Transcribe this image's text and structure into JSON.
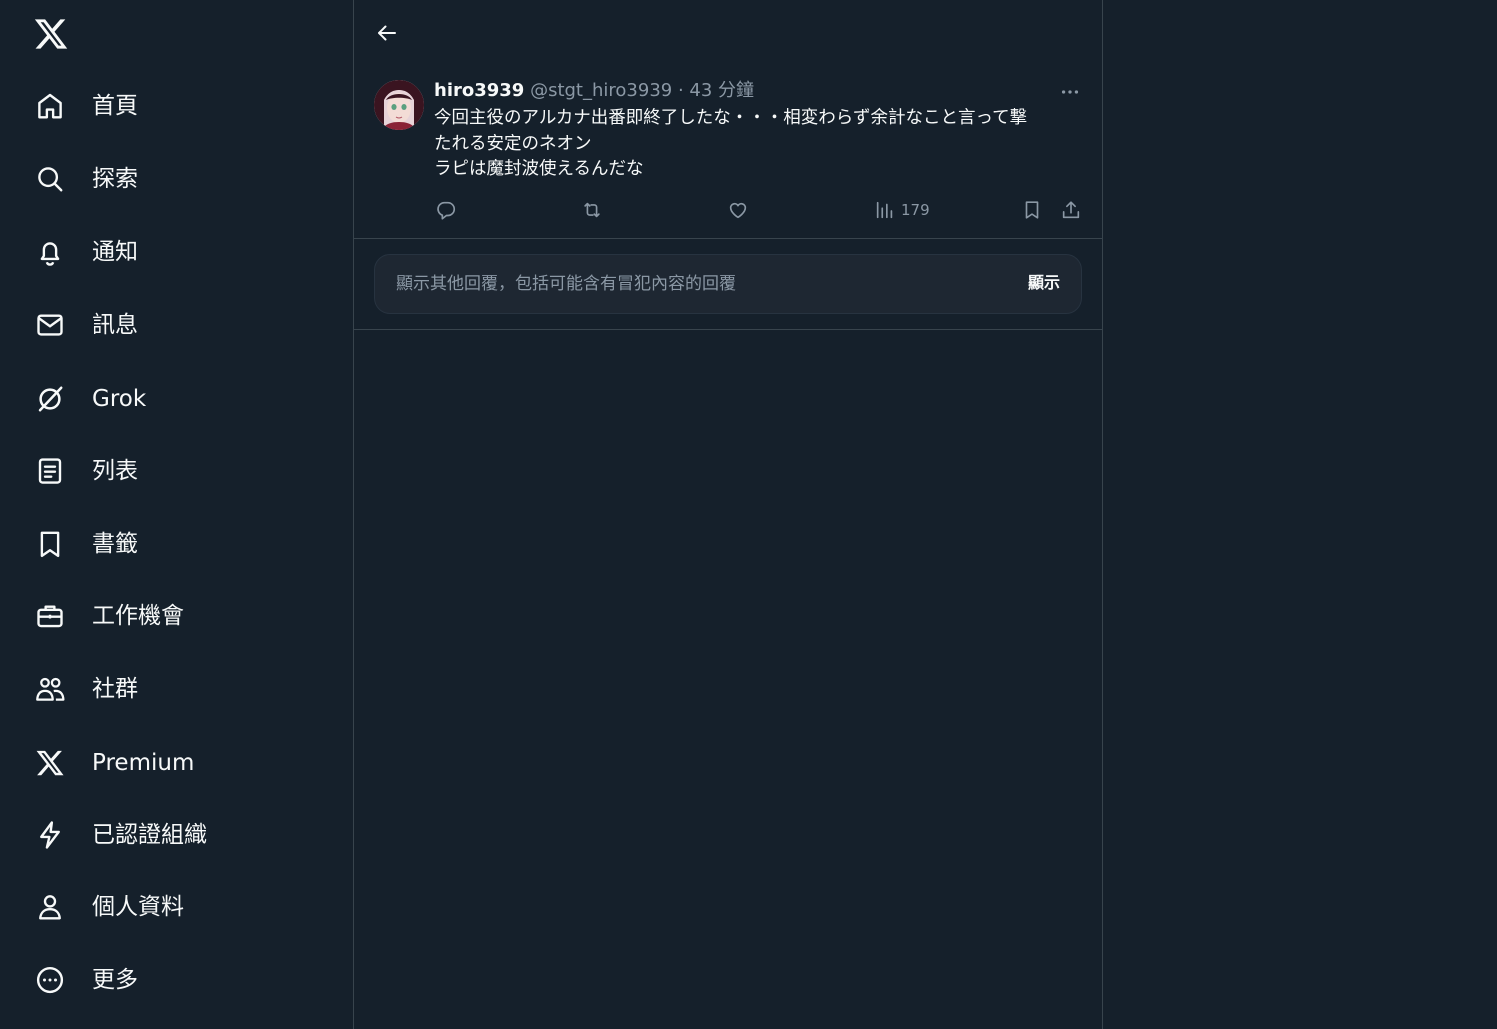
{
  "sidebar": {
    "items": [
      {
        "label": "首頁",
        "icon": "home-icon"
      },
      {
        "label": "探索",
        "icon": "search-icon"
      },
      {
        "label": "通知",
        "icon": "bell-icon"
      },
      {
        "label": "訊息",
        "icon": "mail-icon"
      },
      {
        "label": "Grok",
        "icon": "grok-icon"
      },
      {
        "label": "列表",
        "icon": "list-icon"
      },
      {
        "label": "書籤",
        "icon": "bookmark-icon"
      },
      {
        "label": "工作機會",
        "icon": "briefcase-icon"
      },
      {
        "label": "社群",
        "icon": "communities-icon"
      },
      {
        "label": "Premium",
        "icon": "x-premium-icon"
      },
      {
        "label": "已認證組織",
        "icon": "lightning-icon"
      },
      {
        "label": "個人資料",
        "icon": "person-icon"
      },
      {
        "label": "更多",
        "icon": "more-circle-icon"
      }
    ]
  },
  "tweet": {
    "display_name": "hiro3939",
    "handle": "@stgt_hiro3939",
    "separator": "·",
    "timestamp": "43 分鐘",
    "text_lines": [
      "今回主役のアルカナ出番即終了したな・・・相変わらず余計なこと言って撃",
      "たれる安定のネオン",
      "ラピは魔封波使えるんだな"
    ],
    "views": "179"
  },
  "reveal": {
    "text": "顯示其他回覆，包括可能含有冒犯內容的回覆",
    "button": "顯示"
  },
  "colors": {
    "background": "#15202b",
    "border": "#38444d",
    "text": "#f7f9f9",
    "muted": "#8b98a5"
  }
}
